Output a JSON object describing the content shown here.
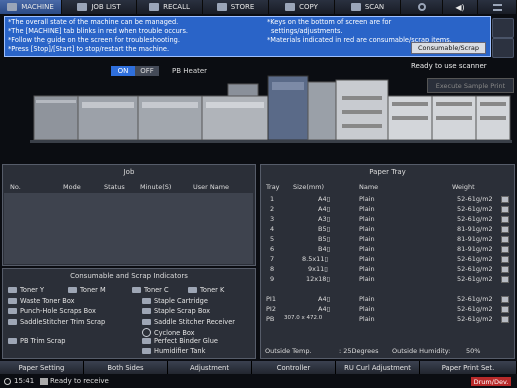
{
  "tabs": [
    {
      "label": "MACHINE",
      "icon": "machine-icon",
      "active": true
    },
    {
      "label": "JOB LIST",
      "icon": "job-list-icon"
    },
    {
      "label": "RECALL",
      "icon": "recall-icon"
    },
    {
      "label": "STORE",
      "icon": "store-icon"
    },
    {
      "label": "COPY",
      "icon": "copy-icon"
    },
    {
      "label": "SCAN",
      "icon": "scan-icon"
    }
  ],
  "info": {
    "left": [
      "*The overall state of the machine can be managed.",
      "*The [MACHINE] tab blinks in red when trouble occurs.",
      "*Follow the guide on the screen for troubleshooting.",
      "*Press [Stop]/[Start] to stop/restart the machine."
    ],
    "right": [
      "*Keys on the bottom of screen are for",
      "settings/adjustments.",
      "*Materials indicated in red are consumable/scrap items."
    ],
    "button": "Consumable/Scrap"
  },
  "pb_heater": {
    "on": "ON",
    "off": "OFF",
    "label": "PB Heater"
  },
  "status_message": "Ready to use scanner",
  "sample_print": "Execute Sample Print",
  "job": {
    "title": "Job",
    "columns": [
      "No.",
      "Mode",
      "Status",
      "Minute(S)",
      "User Name"
    ]
  },
  "paper_tray": {
    "title": "Paper Tray",
    "columns": [
      "Tray",
      "Size(mm)",
      "Name",
      "Weight"
    ],
    "rows": [
      {
        "tray": "1",
        "size": "A4▯",
        "name": "Plain",
        "weight": "52-61g/m2"
      },
      {
        "tray": "2",
        "size": "A4▯",
        "name": "Plain",
        "weight": "52-61g/m2"
      },
      {
        "tray": "3",
        "size": "A3▯",
        "name": "Plain",
        "weight": "52-61g/m2"
      },
      {
        "tray": "4",
        "size": "B5▯",
        "name": "Plain",
        "weight": "81-91g/m2"
      },
      {
        "tray": "5",
        "size": "B5▯",
        "name": "Plain",
        "weight": "81-91g/m2"
      },
      {
        "tray": "6",
        "size": "B4▯",
        "name": "Plain",
        "weight": "81-91g/m2"
      },
      {
        "tray": "7",
        "size": "8.5x11▯",
        "name": "Plain",
        "weight": "52-61g/m2"
      },
      {
        "tray": "8",
        "size": "9x11▯",
        "name": "Plain",
        "weight": "52-61g/m2"
      },
      {
        "tray": "9",
        "size": "12x18▯",
        "name": "Plain",
        "weight": "52-61g/m2"
      },
      {
        "tray": "PI1",
        "size": "A4▯",
        "name": "Plain",
        "weight": "52-61g/m2"
      },
      {
        "tray": "PI2",
        "size": "A4▯",
        "name": "Plain",
        "weight": "52-61g/m2"
      },
      {
        "tray": "PB",
        "size": "307.0 x 472.0",
        "name": "Plain",
        "weight": "52-61g/m2"
      }
    ],
    "outside_temp_label": "Outside Temp.",
    "outside_temp": ": 25Degrees",
    "outside_humidity_label": "Outside Humidity:",
    "outside_humidity": "50%"
  },
  "consumables": {
    "title": "Consumable and Scrap Indicators",
    "col1": [
      {
        "label": "Toner Y",
        "icon": "toner-y-icon"
      },
      {
        "label": "Waste Toner Box",
        "icon": "waste-toner-box-icon"
      },
      {
        "label": "Punch-Hole Scraps Box",
        "icon": "punch-hole-scraps-box-icon"
      },
      {
        "label": "SaddleStitcher Trim Scrap",
        "icon": "saddlestitcher-trim-scrap-icon"
      },
      {
        "label": "PB Trim Scrap",
        "icon": "pb-trim-scrap-icon"
      }
    ],
    "col2": [
      {
        "label": "Toner M",
        "icon": "toner-m-icon"
      }
    ],
    "col3": [
      {
        "label": "Toner C",
        "icon": "toner-c-icon"
      },
      {
        "label": "Staple Cartridge",
        "icon": "staple-cartridge-icon"
      },
      {
        "label": "Staple Scrap Box",
        "icon": "staple-scrap-box-icon"
      },
      {
        "label": "Saddle Stitcher Receiver",
        "icon": "saddle-stitcher-receiver-icon"
      },
      {
        "label": "Cyclone Box",
        "icon": "cyclone-box-icon"
      },
      {
        "label": "Perfect Binder Glue",
        "icon": "perfect-binder-glue-icon"
      },
      {
        "label": "Humidifier Tank",
        "icon": "humidifier-tank-icon"
      }
    ],
    "col4": [
      {
        "label": "Toner K",
        "icon": "toner-k-icon"
      }
    ]
  },
  "bottom_buttons": [
    "Paper Setting",
    "Both Sides",
    "Adjustment",
    "Controller",
    "RU Curl Adjustment",
    "Paper Print Set."
  ],
  "statusbar": {
    "time": "15:41",
    "message": "Ready to receive",
    "drum": "Drum/Dev."
  }
}
